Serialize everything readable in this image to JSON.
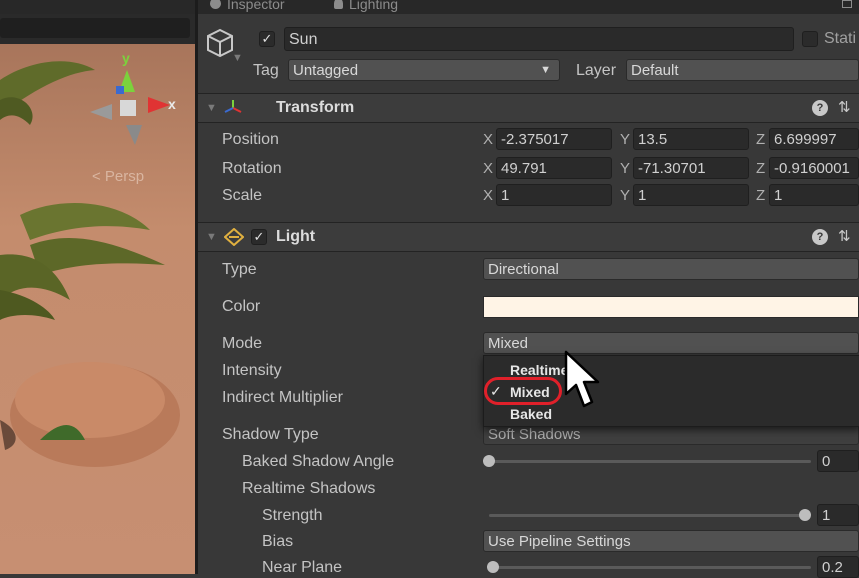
{
  "scene": {
    "gizmo": {
      "y_axis": "y",
      "x_axis": "x",
      "persp_label": "< Persp"
    }
  },
  "tabs": {
    "inspector": "Inspector",
    "lighting": "Lighting"
  },
  "object": {
    "name": "Sun",
    "static_label": "Stati",
    "tag_label": "Tag",
    "tag_value": "Untagged",
    "layer_label": "Layer",
    "layer_value": "Default"
  },
  "transform": {
    "title": "Transform",
    "rows": [
      {
        "label": "Position",
        "x": "-2.375017",
        "y": "13.5",
        "z": "6.699997"
      },
      {
        "label": "Rotation",
        "x": "49.791",
        "y": "-71.30701",
        "z": "-0.9160001"
      },
      {
        "label": "Scale",
        "x": "1",
        "y": "1",
        "z": "1"
      }
    ]
  },
  "light": {
    "title": "Light",
    "type_label": "Type",
    "type_value": "Directional",
    "color_label": "Color",
    "color_value": "#fff4e6",
    "mode_label": "Mode",
    "mode_value": "Mixed",
    "intensity_label": "Intensity",
    "indirect_label": "Indirect Multiplier",
    "shadow_type_label": "Shadow Type",
    "shadow_type_value": "Soft Shadows",
    "baked_angle_label": "Baked Shadow Angle",
    "baked_angle_value": "0",
    "realtime_shadows_label": "Realtime Shadows",
    "strength_label": "Strength",
    "strength_value": "1",
    "bias_label": "Bias",
    "bias_value": "Use Pipeline Settings",
    "near_plane_label": "Near Plane",
    "near_plane_value": "0.2"
  },
  "mode_menu": {
    "options": [
      "Realtime",
      "Mixed",
      "Baked"
    ],
    "selected": "Mixed",
    "highlight_color": "#e0202a"
  },
  "axes": {
    "x": "X",
    "y": "Y",
    "z": "Z"
  }
}
